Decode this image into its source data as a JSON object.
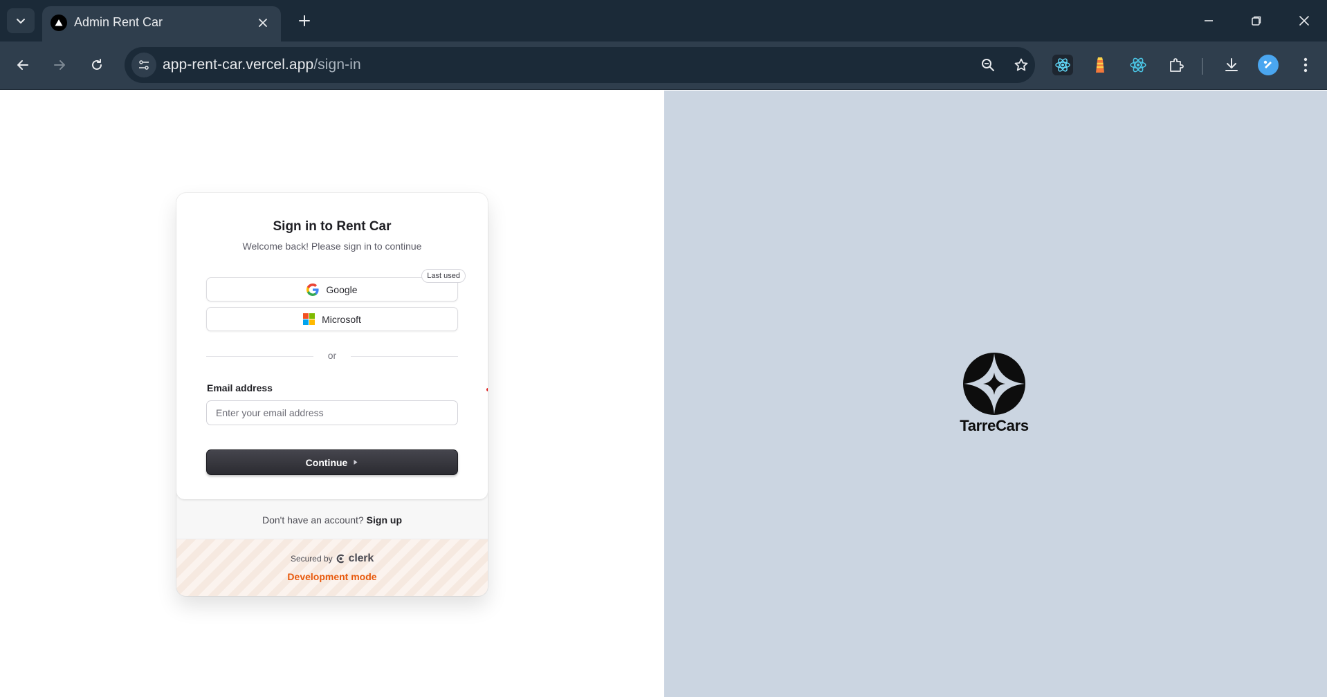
{
  "browser": {
    "tab_title": "Admin Rent Car",
    "url_host": "app-rent-car.vercel.app",
    "url_path": "/sign-in"
  },
  "signin": {
    "title": "Sign in to Rent Car",
    "subtitle": "Welcome back! Please sign in to continue",
    "google_label": "Google",
    "microsoft_label": "Microsoft",
    "last_used_badge": "Last used",
    "divider_text": "or",
    "email_label": "Email address",
    "email_placeholder": "Enter your email address",
    "email_value": "",
    "continue_label": "Continue",
    "no_account_text": "Don't have an account?",
    "signup_link": "Sign up",
    "secured_by": "Secured by",
    "clerk_brand": "clerk",
    "dev_mode": "Development mode"
  },
  "brand": {
    "name": "TarreCars"
  },
  "colors": {
    "chrome_dark": "#1b2a38",
    "chrome_toolbar": "#2f3e4d",
    "right_panel": "#cbd5e1",
    "button_dark": "#2b2b31",
    "dev_mode_orange": "#e8590c"
  },
  "icons": [
    "tab-search-icon",
    "vercel-triangle-icon",
    "close-icon",
    "plus-icon",
    "minimize-icon",
    "restore-icon",
    "back-arrow-icon",
    "forward-arrow-icon",
    "reload-icon",
    "site-settings-icon",
    "zoom-icon",
    "star-icon",
    "react-devtools-icon",
    "lighthouse-icon",
    "react-icon",
    "extensions-puzzle-icon",
    "download-icon",
    "profile-avatar-icon",
    "kebab-menu-icon",
    "google-icon",
    "microsoft-icon",
    "play-triangle-icon",
    "clerk-logo-icon",
    "tarrecars-logo-icon"
  ]
}
